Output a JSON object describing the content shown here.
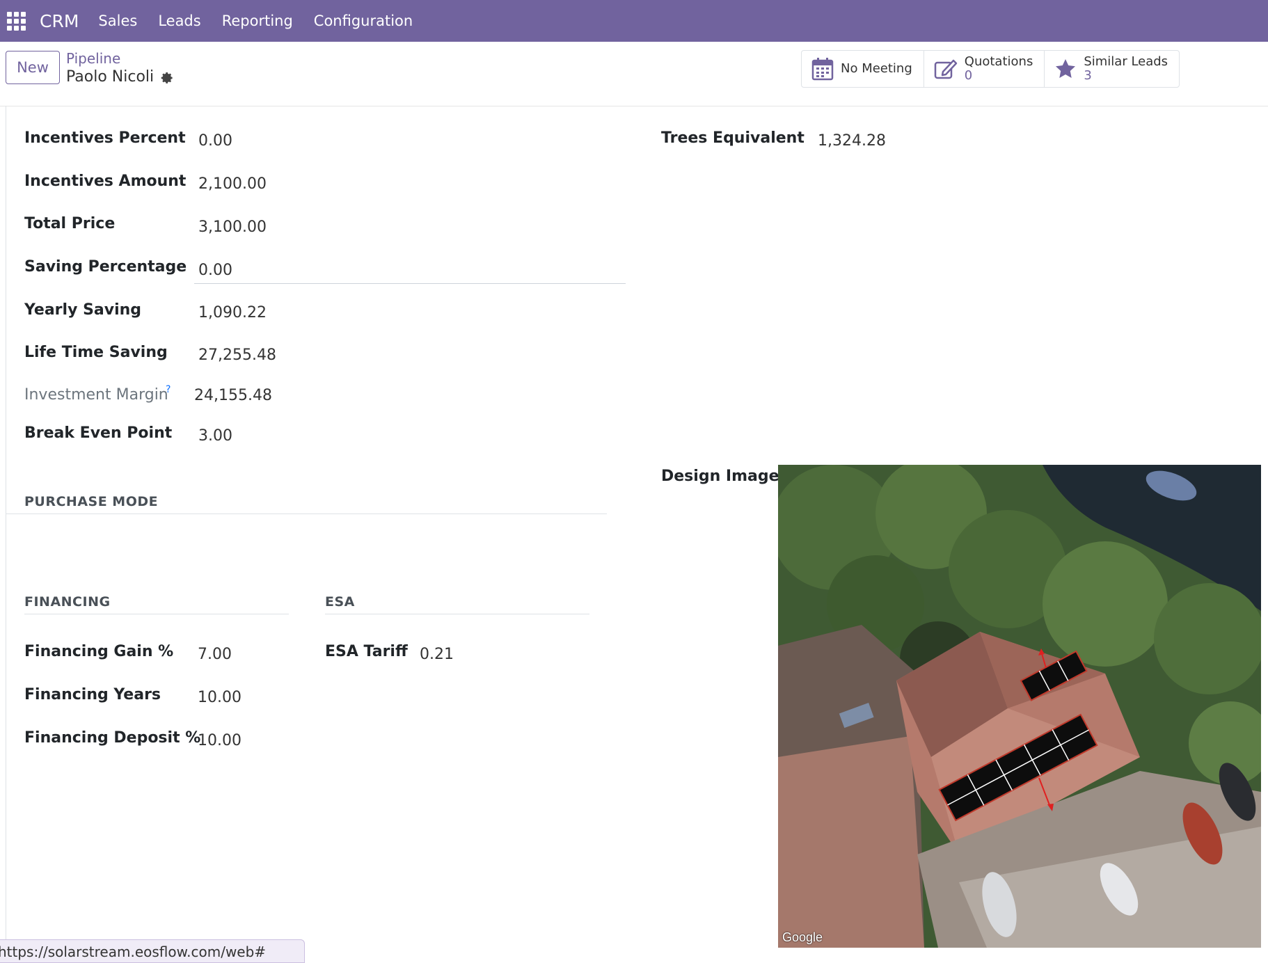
{
  "nav": {
    "app_name": "CRM",
    "menus": [
      "Sales",
      "Leads",
      "Reporting",
      "Configuration"
    ]
  },
  "control": {
    "new_label": "New",
    "breadcrumb_parent": "Pipeline",
    "record_name": "Paolo Nicoli",
    "stats": {
      "meeting": "No Meeting",
      "quotations_label": "Quotations",
      "quotations_value": "0",
      "similar_label": "Similar Leads",
      "similar_value": "3"
    }
  },
  "fields": {
    "incentives_percent": {
      "label": "Incentives Percent",
      "value": "0.00"
    },
    "incentives_amount": {
      "label": "Incentives Amount",
      "value": "2,100.00"
    },
    "total_price": {
      "label": "Total Price",
      "value": "3,100.00"
    },
    "saving_percentage": {
      "label": "Saving Percentage",
      "value": "0.00"
    },
    "yearly_saving": {
      "label": "Yearly Saving",
      "value": "1,090.22"
    },
    "life_time_saving": {
      "label": "Life Time Saving",
      "value": "27,255.48"
    },
    "investment_margin": {
      "label": "Investment Margin",
      "help": "?",
      "value": "24,155.48"
    },
    "break_even_point": {
      "label": "Break Even Point",
      "value": "3.00"
    },
    "trees_equivalent": {
      "label": "Trees Equivalent",
      "value": "1,324.28"
    },
    "design_image": {
      "label": "Design Image",
      "map_attribution": "Google"
    }
  },
  "sections": {
    "purchase_mode": "PURCHASE MODE",
    "financing": "FINANCING",
    "esa": "ESA"
  },
  "financing": {
    "gain": {
      "label": "Financing Gain %",
      "value": "7.00"
    },
    "years": {
      "label": "Financing Years",
      "value": "10.00"
    },
    "deposit": {
      "label": "Financing Deposit %",
      "value": "10.00"
    }
  },
  "esa": {
    "tariff": {
      "label": "ESA Tariff",
      "value": "0.21"
    }
  },
  "status_url": "https://solarstream.eosflow.com/web#",
  "colors": {
    "brand": "#71639e",
    "accent_link": "#71639e"
  }
}
